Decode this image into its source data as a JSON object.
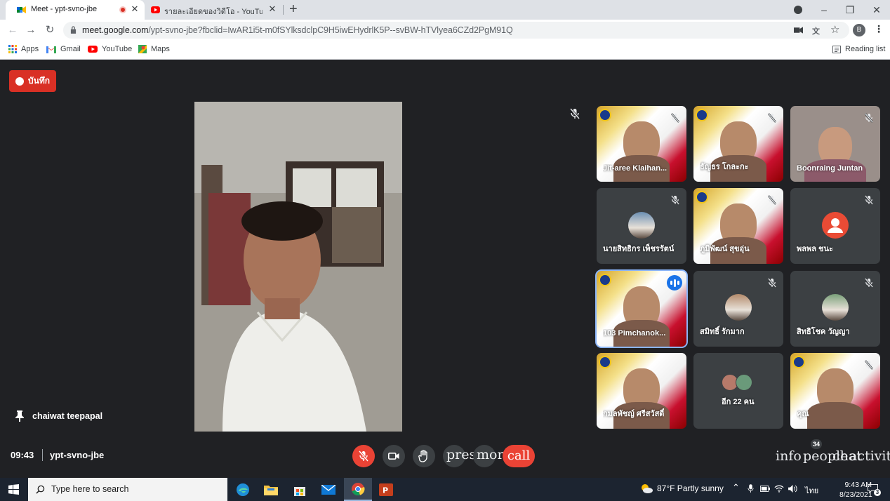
{
  "browser": {
    "tabs": [
      {
        "title": "Meet - ypt-svno-jbe",
        "recording": true
      },
      {
        "title": "รายละเอียดของวิดีโอ - YouTube Studio"
      }
    ],
    "new_tab": "+",
    "window_controls": {
      "minimize": "–",
      "restore": "❐",
      "close": "✕"
    },
    "url_host": "meet.google.com",
    "url_path": "/ypt-svno-jbe?fbclid=IwAR1i5t-m0fSYlksdclpC9H5iwEHydrlK5P--svBW-hTVlyea6CZd2PgM91Q",
    "profile_initial": "B",
    "bookmarks": [
      {
        "label": "Apps",
        "icon": "apps-grid-icon"
      },
      {
        "label": "Gmail",
        "icon": "gmail-icon"
      },
      {
        "label": "YouTube",
        "icon": "youtube-icon"
      },
      {
        "label": "Maps",
        "icon": "maps-icon"
      }
    ],
    "reading_list": "Reading list"
  },
  "meet": {
    "record_label": "บันทึก",
    "pinned_name": "chaiwat teepapal",
    "participants": [
      {
        "name": "Jit-aree Klaihan...",
        "muted": true,
        "bg": "poster"
      },
      {
        "name": "ธัญธร โกละกะ",
        "muted": true,
        "bg": "poster"
      },
      {
        "name": "Boonraing Juntan",
        "muted": true,
        "bg": "photo"
      },
      {
        "name": "นายสิทธิกร เพ็ชรรัตน์",
        "muted": true,
        "bg": "avatar"
      },
      {
        "name": "ภูมิพัฒน์ สุขอุ่น",
        "muted": true,
        "bg": "poster"
      },
      {
        "name": "พลพล ชนะ",
        "muted": true,
        "bg": "letter"
      },
      {
        "name": "103 Pimchanok...",
        "muted": false,
        "speaking": true,
        "bg": "poster"
      },
      {
        "name": "สมิทธิ์ รักมาก",
        "muted": true,
        "bg": "avatar"
      },
      {
        "name": "สิทธิโชค วัญญา",
        "muted": true,
        "bg": "avatar"
      },
      {
        "name": "กมลพัชญ์ ศรีสวัสดิ์",
        "muted": false,
        "bg": "poster"
      },
      {
        "name": "อีก 22 คน",
        "muted": false,
        "bg": "others"
      },
      {
        "name": "คุณ",
        "muted": true,
        "bg": "poster"
      }
    ],
    "clock": "09:43",
    "meeting_code": "ypt-svno-jbe",
    "controls": {
      "present": "prese",
      "more": "more",
      "end": "call",
      "info": "info",
      "people": "people",
      "chat": "chat",
      "activities": "activities"
    },
    "people_count": "34"
  },
  "taskbar": {
    "search_placeholder": "Type here to search",
    "weather": "87°F  Partly sunny",
    "language": "ไทย",
    "time": "9:43 AM",
    "date": "8/23/2021",
    "notification_count": "3"
  },
  "colors": {
    "meet_bg": "#202124",
    "record_red": "#d93025",
    "end_call_red": "#ea4335",
    "tile_bg": "#3c4043",
    "speaking_outline": "#8ab4f8",
    "taskbar_bg": "#1c2430"
  }
}
